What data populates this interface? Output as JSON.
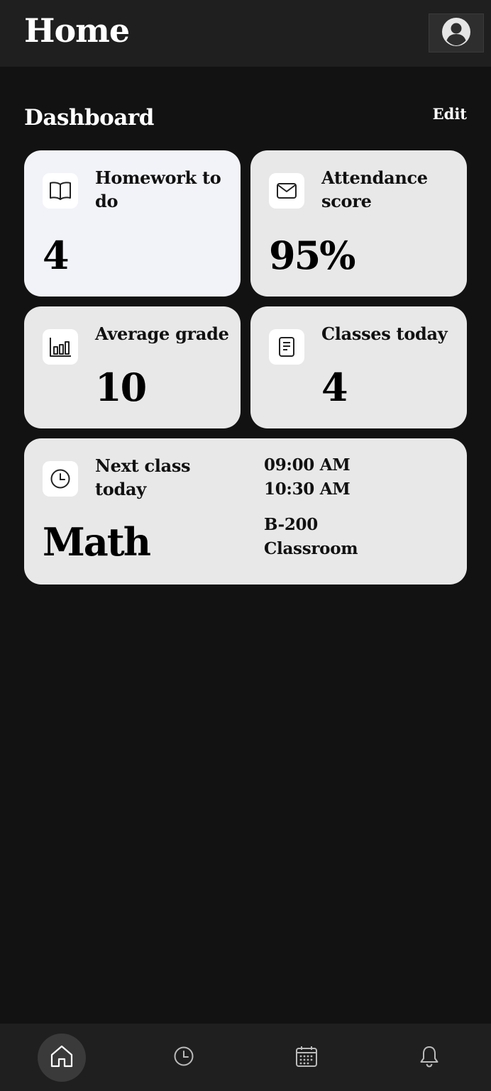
{
  "header": {
    "title": "Home",
    "profile_icon": "user-circle-icon"
  },
  "dashboard": {
    "title": "Dashboard",
    "edit_label": "Edit",
    "cards": [
      {
        "label": "Homework to do",
        "value": "4",
        "icon": "book-icon"
      },
      {
        "label": "Attendance score",
        "value": "95%",
        "icon": "mail-icon"
      },
      {
        "label": "Average grade",
        "value": "10",
        "icon": "bar-chart-icon"
      },
      {
        "label": "Classes today",
        "value": "4",
        "icon": "document-icon"
      }
    ],
    "next_class": {
      "label": "Next class today",
      "subject": "Math",
      "start_time": "09:00 AM",
      "end_time": "10:30 AM",
      "room": "B-200",
      "room_type": "Classroom",
      "icon": "clock-icon"
    }
  },
  "bottom_nav": {
    "items": [
      {
        "icon": "home-icon",
        "active": true
      },
      {
        "icon": "clock-icon",
        "active": false
      },
      {
        "icon": "calendar-icon",
        "active": false
      },
      {
        "icon": "bell-icon",
        "active": false
      }
    ]
  },
  "colors": {
    "background": "#121212",
    "bar": "#1f1f1f",
    "card": "#e8e8e8",
    "card_highlight": "#f2f3f8"
  }
}
